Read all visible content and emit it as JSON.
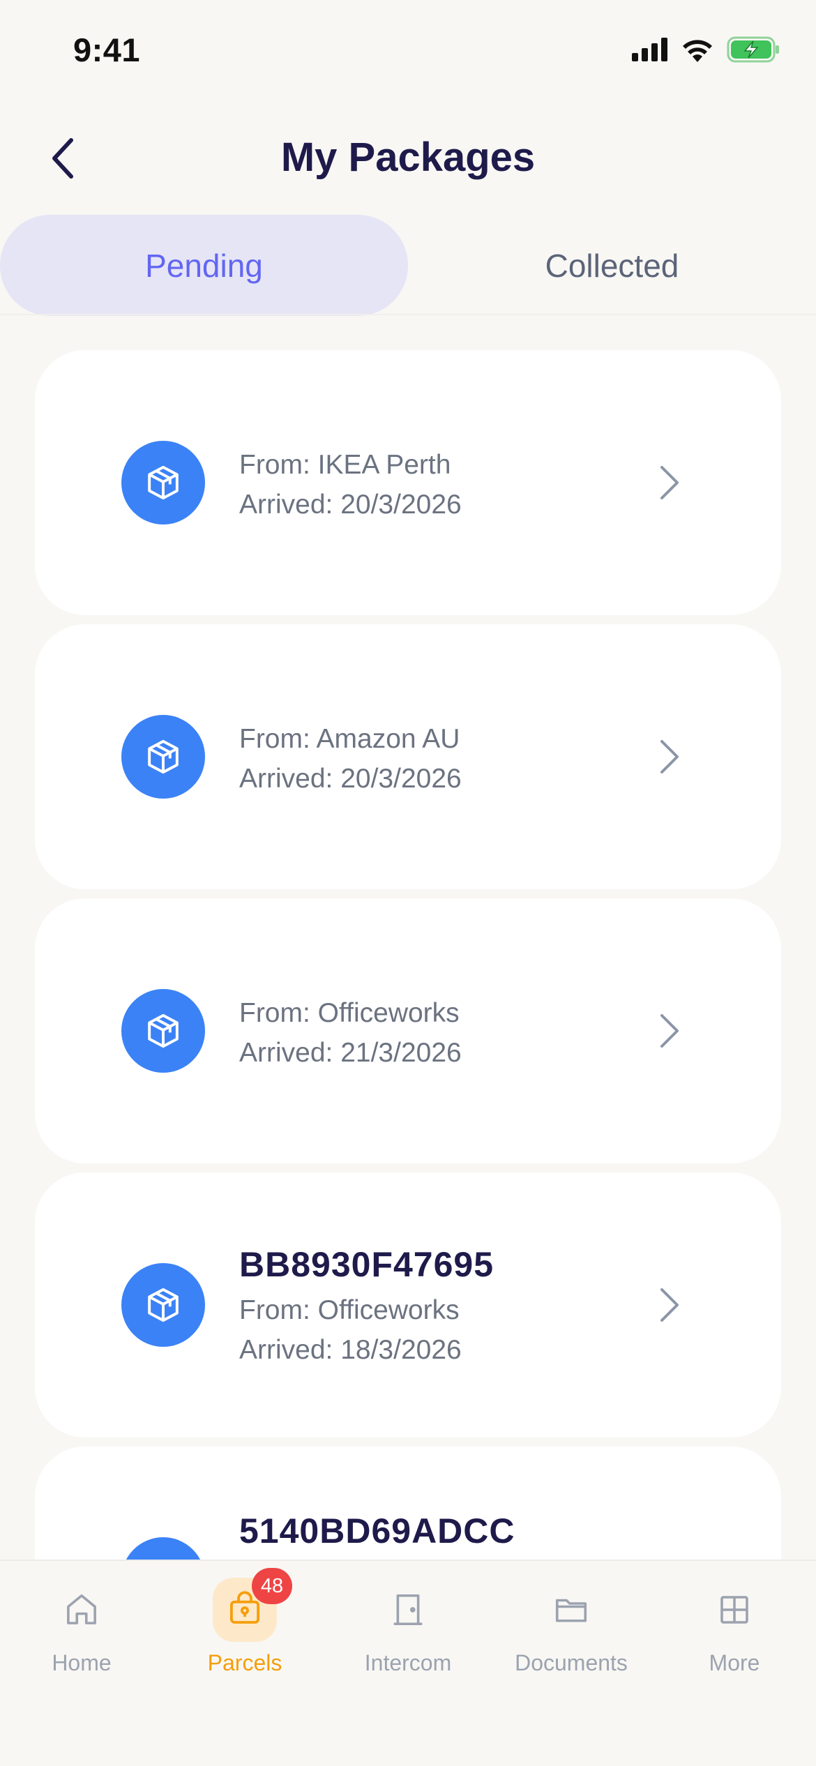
{
  "status_bar": {
    "time": "9:41"
  },
  "header": {
    "title": "My Packages"
  },
  "tabs": [
    {
      "label": "Pending",
      "active": true
    },
    {
      "label": "Collected",
      "active": false
    }
  ],
  "packages": [
    {
      "id": "",
      "from": "From: IKEA Perth",
      "arrived": "Arrived: 20/3/2026"
    },
    {
      "id": "",
      "from": "From: Amazon AU",
      "arrived": "Arrived: 20/3/2026"
    },
    {
      "id": "",
      "from": "From: Officeworks",
      "arrived": "Arrived: 21/3/2026"
    },
    {
      "id": "BB8930F47695",
      "from": "From: Officeworks",
      "arrived": "Arrived: 18/3/2026"
    },
    {
      "id": "5140BD69ADCC"
    }
  ],
  "nav": {
    "items": [
      {
        "label": "Home",
        "icon": "home-icon"
      },
      {
        "label": "Parcels",
        "icon": "parcel-locker-icon",
        "badge": "48",
        "active": true
      },
      {
        "label": "Intercom",
        "icon": "door-icon"
      },
      {
        "label": "Documents",
        "icon": "folder-icon"
      },
      {
        "label": "More",
        "icon": "grid-icon"
      }
    ]
  },
  "colors": {
    "accent": "#6366f1",
    "package_icon_bg": "#3b82f6",
    "active_nav": "#f59e0b",
    "badge": "#ef4444"
  }
}
